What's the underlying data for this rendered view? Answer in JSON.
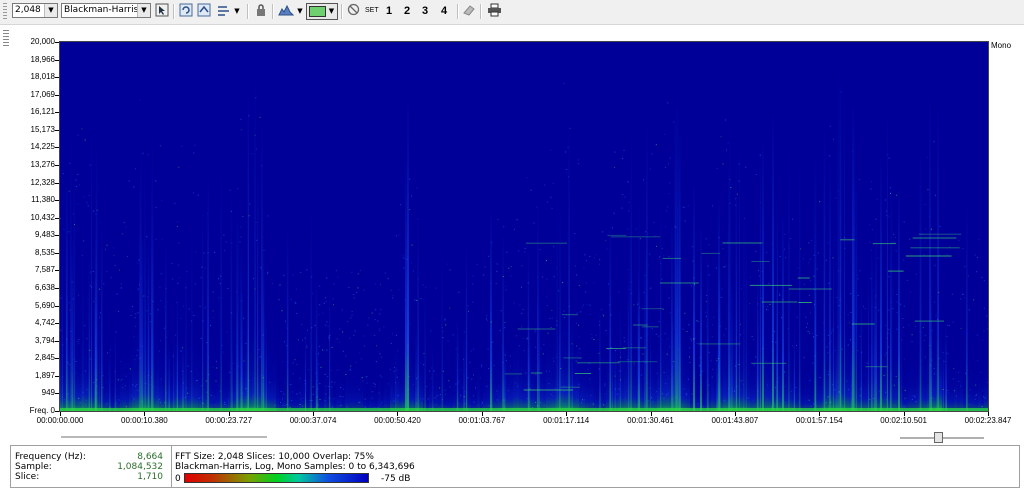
{
  "toolbar": {
    "fft_size": "2,048",
    "window": "Blackman-Harris",
    "set_label": "SET",
    "sets": [
      "1",
      "2",
      "3",
      "4"
    ],
    "colors": {
      "spectrogram_bg": "#000099",
      "accent": "#00c82a"
    }
  },
  "axis": {
    "y_labels": [
      "20,000",
      "18,966",
      "18,018",
      "17,069",
      "16,121",
      "15,173",
      "14,225",
      "13,276",
      "12,328",
      "11,380",
      "10,432",
      "9,483",
      "8,535",
      "7,587",
      "6,638",
      "5,690",
      "4,742",
      "3,794",
      "2,845",
      "1,897",
      "949",
      "Freq. 0"
    ],
    "x_labels": [
      "00:00:00.000",
      "00:00:10.380",
      "00:00:23.727",
      "00:00:37.074",
      "00:00:50.420",
      "00:01:03.767",
      "00:01:17.114",
      "00:01:30.461",
      "00:01:43.807",
      "00:01:57.154",
      "00:02:10.501",
      "00:02:23.847"
    ],
    "channel": "Mono"
  },
  "info": {
    "frequency_label": "Frequency (Hz):",
    "frequency_value": "8,664",
    "sample_label": "Sample:",
    "sample_value": "1,084,532",
    "slice_label": "Slice:",
    "slice_value": "1,710",
    "line1": "FFT Size: 2,048  Slices: 10,000  Overlap: 75%",
    "line2": "Blackman-Harris, Log, Mono  Samples: 0 to 6,343,696",
    "db_min": "0 dB",
    "db_max": "-75 dB"
  },
  "zoom_level": 0.45
}
